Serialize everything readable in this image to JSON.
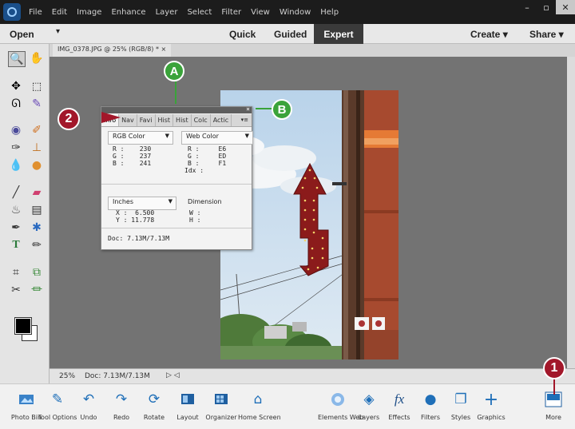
{
  "menubar": {
    "items": [
      "File",
      "Edit",
      "Image",
      "Enhance",
      "Layer",
      "Select",
      "Filter",
      "View",
      "Window",
      "Help"
    ],
    "win_min": "–",
    "win_max": "▫",
    "win_close": "✕"
  },
  "modebar": {
    "open": "Open",
    "open_caret": "▾",
    "quick": "Quick",
    "guided": "Guided",
    "expert": "Expert",
    "create": "Create ▾",
    "share": "Share ▾"
  },
  "document": {
    "tab_title": "IMG_0378.JPG @ 25% (RGB/8) * ×"
  },
  "status": {
    "zoom": "25%",
    "doc": "Doc: 7.13M/7.13M",
    "nav": "▷ ◁"
  },
  "info_panel": {
    "tabs": [
      "Info",
      "Nav",
      "Favi",
      "Hist",
      "Hist",
      "Colc",
      "Actic"
    ],
    "menu_icon": "▾≡",
    "close": "×",
    "rgb_mode": "RGB Color",
    "web_mode": "Web Color",
    "rgb_rows": [
      "R :    230",
      "G :    237",
      "B :    241"
    ],
    "web_rows": [
      "R :     E6",
      "G :     ED",
      "B :     F1",
      "Idx :"
    ],
    "unit": "Inches",
    "dimension": "Dimension",
    "xy_rows": [
      "X :  6.500",
      "Y : 11.778"
    ],
    "wh_rows": [
      "W :",
      "H :"
    ],
    "doc": "Doc: 7.13M/7.13M"
  },
  "bottombar": {
    "items": [
      {
        "label": "Photo Bin",
        "icon": "photo-bin-icon"
      },
      {
        "label": "Tool Options",
        "icon": "tool-options-icon"
      },
      {
        "label": "Undo",
        "icon": "undo-icon"
      },
      {
        "label": "Redo",
        "icon": "redo-icon"
      },
      {
        "label": "Rotate",
        "icon": "rotate-icon"
      },
      {
        "label": "Layout",
        "icon": "layout-icon"
      },
      {
        "label": "Organizer",
        "icon": "organizer-icon"
      },
      {
        "label": "Home Screen",
        "icon": "home-icon"
      },
      {
        "label": "Elements Web",
        "icon": "elements-web-icon"
      },
      {
        "label": "Layers",
        "icon": "layers-icon"
      },
      {
        "label": "Effects",
        "icon": "effects-icon"
      },
      {
        "label": "Filters",
        "icon": "filters-icon"
      },
      {
        "label": "Styles",
        "icon": "styles-icon"
      },
      {
        "label": "Graphics",
        "icon": "graphics-icon"
      },
      {
        "label": "More",
        "icon": "more-icon"
      }
    ]
  },
  "callouts": {
    "a": "A",
    "b": "B",
    "two": "2",
    "one": "1"
  },
  "colors": {
    "green_callout": "#3aa33a",
    "red_callout": "#a2172a",
    "accent_blue": "#1f6fb8"
  }
}
